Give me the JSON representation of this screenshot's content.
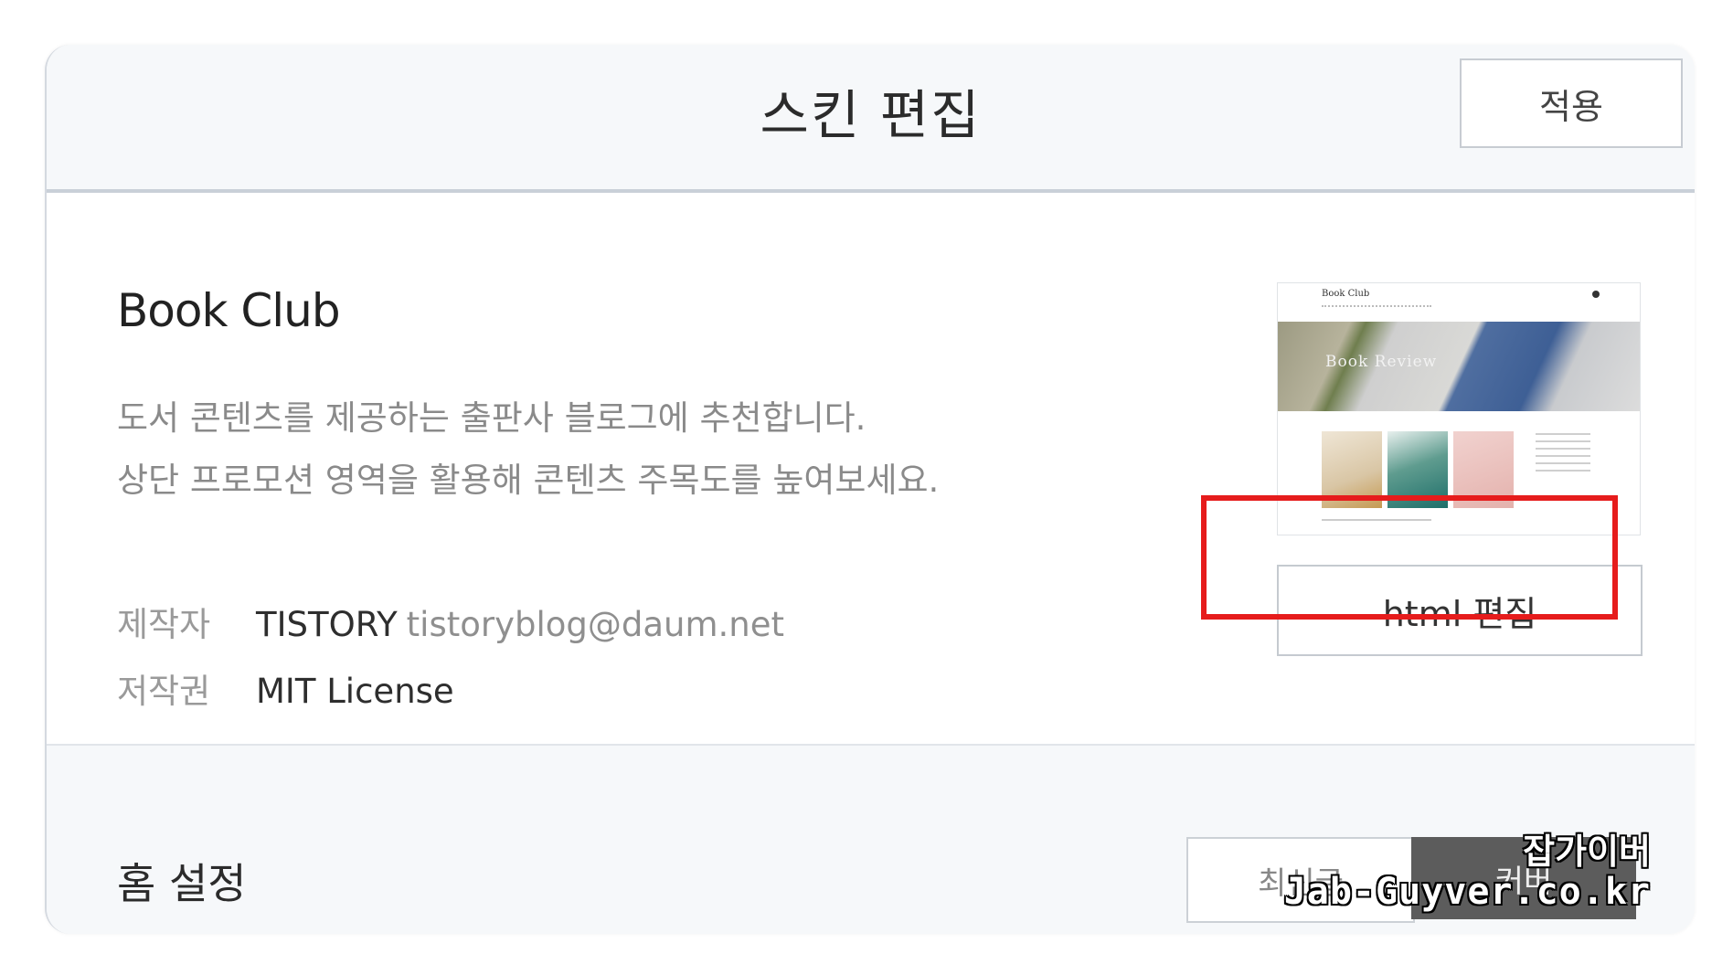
{
  "header": {
    "title": "스킨 편집",
    "apply_label": "적용"
  },
  "skin": {
    "name": "Book Club",
    "description_line1": "도서 콘텐츠를 제공하는 출판사 블로그에 추천합니다.",
    "description_line2": "상단 프로모션 영역을 활용해 콘텐츠 주목도를 높여보세요.",
    "author_label": "제작자",
    "author_name": "TISTORY",
    "author_email": "tistoryblog@daum.net",
    "license_label": "저작권",
    "license_value": "MIT License",
    "preview": {
      "brand": "Book Club",
      "hero_text": "Book Review"
    },
    "html_edit_label": "html 편집"
  },
  "home": {
    "title": "홈 설정",
    "options": [
      "최신글",
      "커버"
    ]
  },
  "watermark": {
    "line1": "잡가이버",
    "line2": "Jab-Guyver.co.kr"
  },
  "colors": {
    "highlight": "#e61c1c",
    "header_bg": "#f6f8fa"
  }
}
